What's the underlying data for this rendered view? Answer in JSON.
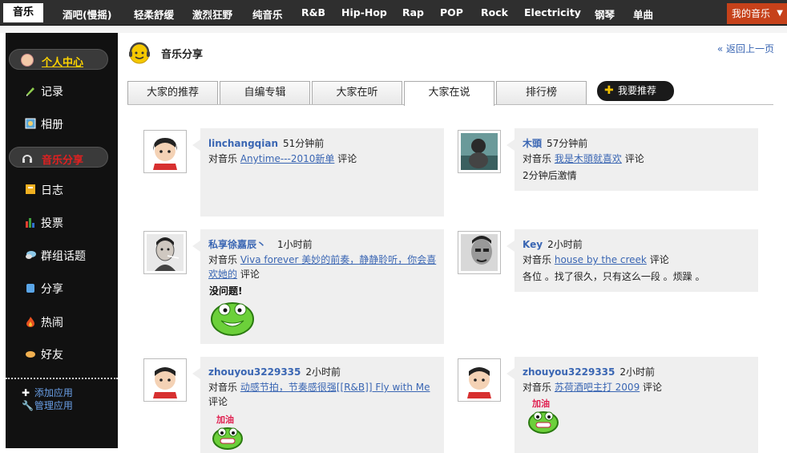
{
  "topnav": {
    "current": "音乐",
    "items": [
      "酒吧(慢摇)",
      "轻柔舒缓",
      "激烈狂野",
      "纯音乐",
      "R&B",
      "Hip-Hop",
      "Rap",
      "POP",
      "Rock",
      "Electricity",
      "钢琴",
      "单曲"
    ],
    "my_music": "我的音乐"
  },
  "sidebar": {
    "profile": "个人中心",
    "items": [
      "记录",
      "相册"
    ],
    "active": "音乐分享",
    "items2": [
      "日志",
      "投票",
      "群组话题",
      "分享",
      "热闹",
      "好友"
    ],
    "apps": [
      "添加应用",
      "管理应用"
    ]
  },
  "main": {
    "title": "音乐分享",
    "back": "« 返回上一页",
    "tabs": [
      "大家的推荐",
      "自编专辑",
      "大家在听",
      "大家在说",
      "排行榜"
    ],
    "active_tab": 3,
    "recommend_button": "我要推荐"
  },
  "posts": [
    {
      "user": "linchangqian",
      "time": "51分钟前",
      "prefix": "对音乐",
      "music": "Anytime---2010新单",
      "suffix": "评论",
      "text": ""
    },
    {
      "user": "木頭",
      "time": "57分钟前",
      "prefix": "对音乐",
      "music": "我是木頭就喜欢",
      "suffix": "评论",
      "text": "2分钟后激情"
    },
    {
      "user": "私享徐嘉辰丶",
      "time": "1小时前",
      "prefix": "对音乐",
      "music": "Viva forever 美妙的前奏，静静聆听，你会喜欢她的",
      "suffix": "评论",
      "text": ""
    },
    {
      "user": "Key",
      "time": "2小时前",
      "prefix": "对音乐",
      "music": "house  by the creek",
      "suffix": "评论",
      "text": "各位 。找了很久，只有这么一段 。烦躁 。"
    },
    {
      "user": "zhouyou3229335",
      "time": "2小时前",
      "prefix": "对音乐",
      "music": "动感节拍，节奏感很强[[R&B]] Fly with Me",
      "suffix": "评论",
      "text": ""
    },
    {
      "user": "zhouyou3229335",
      "time": "2小时前",
      "prefix": "对音乐",
      "music": "苏荷酒吧主打 2009",
      "suffix": "评论",
      "text": ""
    }
  ],
  "emoticons": {
    "no_problem": "没问题!",
    "cheer": "加油"
  },
  "colors": {
    "nav_bg": "#2f2f2f",
    "sidebar_bg": "#111111",
    "link": "#3a66b3",
    "bubble_bg": "#efefef",
    "my_music_bg": "#c6411a"
  }
}
